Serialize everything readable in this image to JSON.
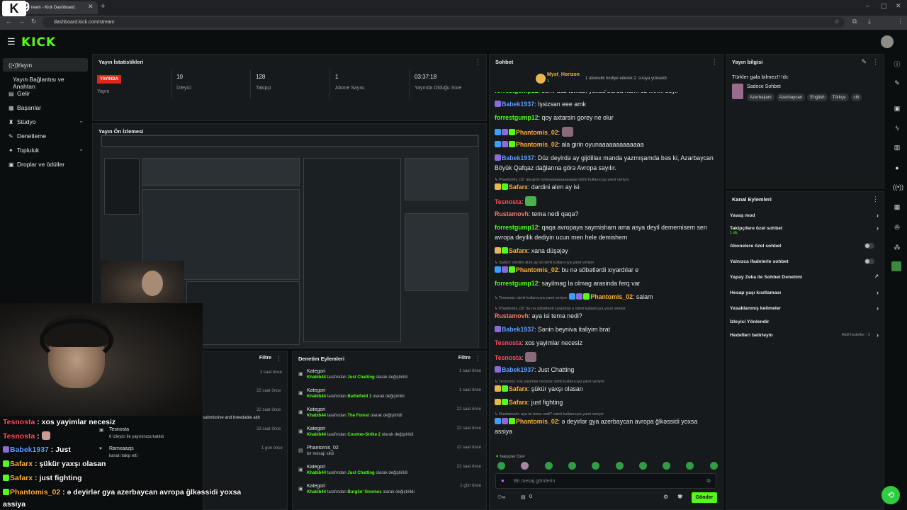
{
  "browser": {
    "tab_title": "ream - Kick Dashboard",
    "url": "dashboard.kick.com/stream",
    "close": "✕",
    "newtab": "+",
    "overlay_number": "9"
  },
  "header": {
    "logo": "KICK"
  },
  "sidebar": {
    "items": [
      {
        "label": "Yayın",
        "icon": "broadcast-icon",
        "glyph": "((•))"
      },
      {
        "label": "Yayın Bağlantısı ve Anahtarı",
        "icon": "none",
        "glyph": ""
      },
      {
        "label": "Gelir",
        "icon": "money-icon",
        "glyph": "▤"
      },
      {
        "label": "Başarılar",
        "icon": "trophy-icon",
        "glyph": "▦"
      },
      {
        "label": "Stüdyo",
        "icon": "studio-icon",
        "glyph": "♜"
      },
      {
        "label": "Denetleme",
        "icon": "hammer-icon",
        "glyph": "✎"
      },
      {
        "label": "Topluluk",
        "icon": "community-icon",
        "glyph": "✦"
      },
      {
        "label": "Droplar ve ödüller",
        "icon": "gift-icon",
        "glyph": "▣"
      }
    ]
  },
  "stats": {
    "title": "Yayın İstatistikleri",
    "live": "YAYINDA",
    "live_label": "Yayın",
    "items": [
      {
        "value": "10",
        "label": "İzleyici"
      },
      {
        "value": "128",
        "label": "Takipçi"
      },
      {
        "value": "1",
        "label": "Abone Sayısı"
      },
      {
        "value": "03:37:18",
        "label": "Yayında Olduğu Süre"
      }
    ]
  },
  "preview": {
    "title": "Yayın Ön İzlemesi"
  },
  "overlay_chat": [
    {
      "user": "Tesnosta",
      "color": "#ff4d5e",
      "text": " : xos yayimlar necesiz"
    },
    {
      "user": "Tesnosta",
      "color": "#ff4d5e",
      "text": " : "
    },
    {
      "user": "Babek1937",
      "color": "#5f9bff",
      "text": " : Just "
    },
    {
      "user": "Safarx",
      "color": "#ffb02e",
      "text": " : şükür yaxşı olasan"
    },
    {
      "user": "Safarx",
      "color": "#ffb02e",
      "text": " : just fighting"
    },
    {
      "user": "Phantomis_02",
      "color": "#ffb02e",
      "text": " : ə deyirlər gya azerbaycan avropa ğlkəssidi yoxsa"
    },
    {
      "user": "",
      "color": "#fff",
      "text": "assiya"
    }
  ],
  "activity_left": {
    "filter": "Filtre",
    "rows": [
      {
        "time": "2 saat önce"
      },
      {
        "time": "22 saat önce"
      },
      {
        "time": "22 saat önce",
        "desc": "submissive and breedable aldı"
      },
      {
        "name": "Tesnosta",
        "desc": "6 İzleyici ile yayınınıza katıldı",
        "time": "23 saat önce"
      },
      {
        "name": "Ramxaazjs",
        "desc": "kanalı takip etti",
        "time": "1 gün önce"
      }
    ]
  },
  "moderation": {
    "title": "Denetim Eylemleri",
    "filter": "Filtre",
    "rows": [
      {
        "kind": "Kategori",
        "by": "Khabib44",
        "mid": " tarafından ",
        "target": "Just Chatting",
        "end": " olarak değiştirildi",
        "time": "1 saat önce"
      },
      {
        "kind": "Kategori",
        "by": "Khabib44",
        "mid": " tarafından ",
        "target": "Battlefield 1",
        "end": " olarak değiştirildi",
        "time": "1 saat önce"
      },
      {
        "kind": "Kategori",
        "by": "Khabib44",
        "mid": " tarafından ",
        "target": "The Forest",
        "end": " olarak değiştirildi",
        "time": "22 saat önce"
      },
      {
        "kind": "Kategori",
        "by": "Khabib44",
        "mid": " tarafından ",
        "target": "Counter-Strike 2",
        "end": " olarak değiştirildi",
        "time": "22 saat önce"
      },
      {
        "kind": "Phantomis_02",
        "by": "",
        "mid": "bir mesajı sildi",
        "target": "",
        "end": "",
        "time": "22 saat önce"
      },
      {
        "kind": "Kategori",
        "by": "Khabib44",
        "mid": " tarafından ",
        "target": "Just Chatting",
        "end": " olarak değiştirildi",
        "time": "22 saat önce"
      },
      {
        "kind": "Kategori",
        "by": "Khabib44",
        "mid": " tarafından ",
        "target": "Burglin' Gnomes",
        "end": " olarak değiştirildi",
        "time": "1 gün önce"
      }
    ]
  },
  "chat": {
    "title": "Sohbet",
    "pinned_user": "Myst_Horizon",
    "pinned_count": "1",
    "pinned_text": "1 abonelik hediye ederek 2. sıraya yükseldi",
    "messages": [
      {
        "user": "forrestgump12",
        "color": "green",
        "text": ": senv duz teması yoxdu burda hamı oz fikrini deyir",
        "badges": []
      },
      {
        "user": "Babek1937",
        "color": "blue",
        "text": ": İşsizsan eee amk",
        "badges": [
          "#8a6bd8"
        ]
      },
      {
        "user": "forrestgump12",
        "color": "green",
        "text": ": qoy axtarsin gorey ne olur",
        "badges": []
      },
      {
        "user": "Phantomis_02",
        "color": "orange",
        "text": ": ",
        "badges": [
          "#3aa0ff",
          "#8a6bd8",
          "#53fc18"
        ]
      },
      {
        "user": "Phantomis_02",
        "color": "orange",
        "text": ": ala girin oyunaaaaaaaaaaaaa",
        "badges": [
          "#3aa0ff",
          "#8a6bd8",
          "#53fc18"
        ]
      },
      {
        "user": "Babek1937",
        "color": "blue",
        "text": ": Düz deyirdə ay gijdillax manda yazmışamda bəs ki, Azarbaycan Böyük Qafqaz dağlarına görə Avropa sayılır.",
        "badges": [
          "#8a6bd8"
        ]
      },
      {
        "reply": "↳ Phantomis_02: ala girin oyunaaaaaaaaaaaaa isimli kullanıcıya yanıt veriyor",
        "user": "Safarx",
        "color": "orange",
        "text": ": dərdini alım ay isi",
        "badges": [
          "#e6b94a",
          "#53fc18"
        ]
      },
      {
        "user": "Tesnosta",
        "color": "red",
        "text": ": ",
        "badges": []
      },
      {
        "user": "Rustamovh",
        "color": "salmon",
        "text": ": tema nedi qaqa?",
        "badges": []
      },
      {
        "user": "forrestgump12",
        "color": "green",
        "text": ": qaqa avropaya saymisham ama asya deyil dememisem sen avropa deyilik dediyin ucun men hele demishem",
        "badges": []
      },
      {
        "user": "Safarx",
        "color": "orange",
        "text": ": xana düşəjəy",
        "badges": [
          "#e6b94a",
          "#53fc18"
        ]
      },
      {
        "reply": "↳ Safarx: dərdini alım ay isi isimli kullanıcıya yanıt veriyor",
        "user": "Phantomis_02",
        "color": "orange",
        "text": ": bu nə söbətlərdi xıyardılar e",
        "badges": [
          "#3aa0ff",
          "#8a6bd8",
          "#53fc18"
        ]
      },
      {
        "user": "forrestgump12",
        "color": "green",
        "text": ": sayilmag la olmag arasinda ferq var",
        "badges": []
      },
      {
        "inline_reply": "↳ Tesnosta:  isimli kullanıcıya yanıt veriyor",
        "user": "Phantomis_02",
        "color": "orange",
        "text": ": salam",
        "badges": [
          "#3aa0ff",
          "#8a6bd8",
          "#53fc18"
        ]
      },
      {
        "reply": "↳ Phantomis_02: bu nə söbətlərdi xıyardılar e isimli kullanıcıya yanıt veriyor",
        "user": "Rustamovh",
        "color": "salmon",
        "text": ": aya isi tema nedi?",
        "badges": []
      },
      {
        "user": "Babek1937",
        "color": "blue",
        "text": ": Sənin beyniva italiyim brat",
        "badges": [
          "#8a6bd8"
        ]
      },
      {
        "user": "Tesnosta",
        "color": "red",
        "text": ": xos yayimlar necesiz",
        "badges": []
      },
      {
        "user": "Tesnosta",
        "color": "red",
        "text": ": ",
        "badges": []
      },
      {
        "user": "Babek1937",
        "color": "blue",
        "text": ": Just Chatting",
        "badges": [
          "#8a6bd8"
        ]
      },
      {
        "reply": "↳ Tesnosta: xos yayimlar necesiz isimli kullanıcıya yanıt veriyor",
        "user": "Safarx",
        "color": "orange",
        "text": ": şükür yaxşı olasan",
        "badges": [
          "#e6b94a",
          "#53fc18"
        ]
      },
      {
        "user": "Safarx",
        "color": "orange",
        "text": ": just fighting",
        "badges": [
          "#e6b94a",
          "#53fc18"
        ]
      },
      {
        "reply": "↳ Rustamovh: aya isi tema nedi? isimli kullanıcıya yanıt veriyor",
        "user": "Phantomis_02",
        "color": "orange",
        "text": ": ə deyirlər gya azerbaycan avropa ğlkəssidi yoxsa assiya",
        "badges": [
          "#3aa0ff",
          "#8a6bd8",
          "#53fc18"
        ]
      }
    ],
    "followers_only": "Takipçiler Özel",
    "input_placeholder": "Bir mesaj gönderin",
    "viewer_count": "0",
    "send": "Gönder"
  },
  "stream_info": {
    "title": "Yayın bilgisi",
    "stream_title": "Türkler gəla bilmez!! !dc",
    "category": "Sadece Sohbet",
    "tags": [
      "Azerbaijani",
      "Azerbaycan",
      "English",
      "Türkçe",
      "chi"
    ]
  },
  "channel_actions": {
    "title": "Kanal Eylemleri",
    "items": [
      {
        "label": "Yavaş mod",
        "kind": "arrow"
      },
      {
        "label": "Takipçilere özel sohbet",
        "sub": "1 dk.",
        "kind": "arrow"
      },
      {
        "label": "Abonelere özel sohbet",
        "kind": "toggle"
      },
      {
        "label": "Yalnızca ifadelerle sohbet",
        "kind": "toggle"
      },
      {
        "label": "Yapay Zeka ile Sohbet Denetimi",
        "kind": "external"
      },
      {
        "label": "Hesap yaşı kısıtlaması",
        "kind": "arrow"
      },
      {
        "label": "Yasaklanmış kelimeler",
        "kind": "arrow"
      },
      {
        "label": "İzleyici Yönlendir",
        "kind": "none"
      },
      {
        "label": "Hedefleri belirleyin",
        "sub": "Aktif hedefler - 2",
        "kind": "arrow"
      }
    ]
  }
}
